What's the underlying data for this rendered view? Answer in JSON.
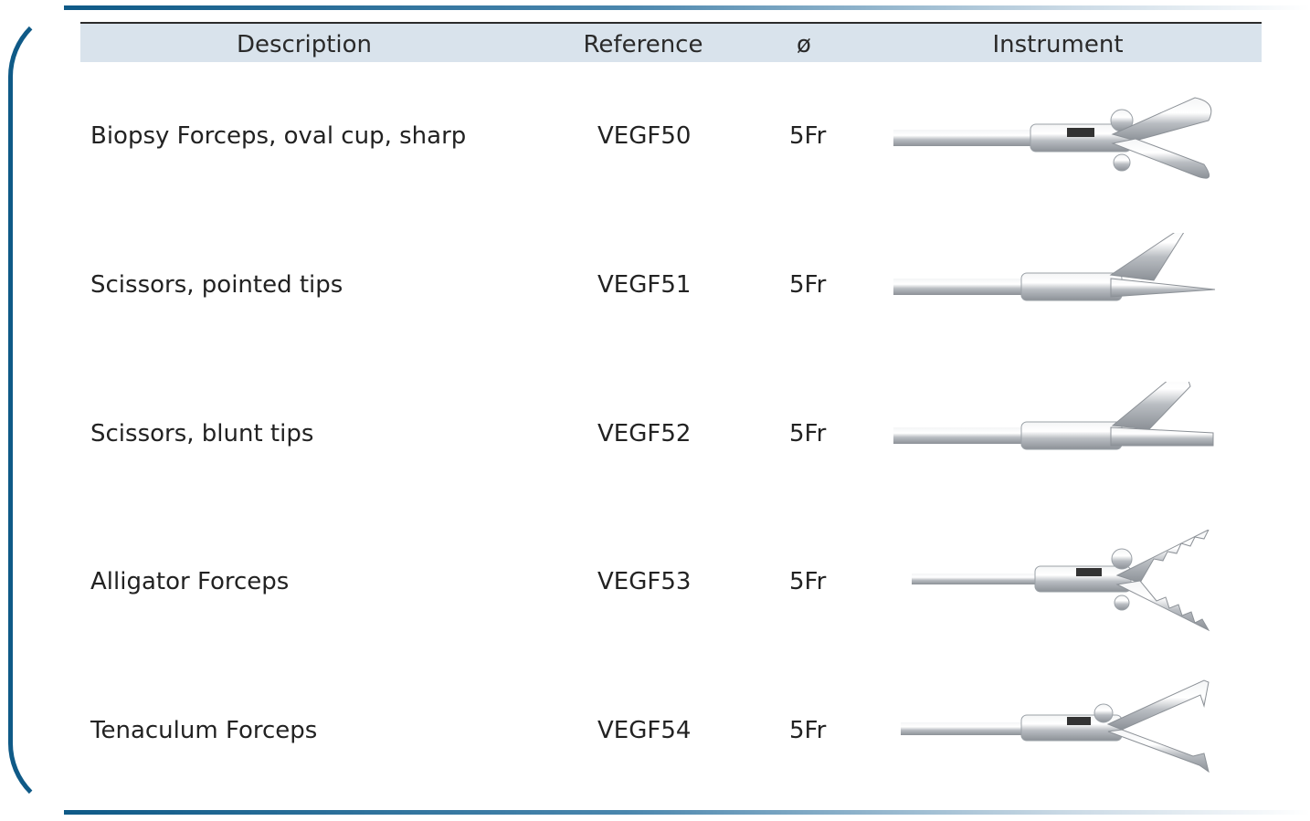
{
  "table": {
    "headers": {
      "description": "Description",
      "reference": "Reference",
      "diameter": "ø",
      "instrument": "Instrument"
    },
    "rows": [
      {
        "description": "Biopsy Forceps, oval cup, sharp",
        "reference": "VEGF50",
        "diameter": "5Fr",
        "instrument_icon": "biopsy-forceps-icon"
      },
      {
        "description": "Scissors, pointed tips",
        "reference": "VEGF51",
        "diameter": "5Fr",
        "instrument_icon": "pointed-scissors-icon"
      },
      {
        "description": "Scissors, blunt tips",
        "reference": "VEGF52",
        "diameter": "5Fr",
        "instrument_icon": "blunt-scissors-icon"
      },
      {
        "description": "Alligator Forceps",
        "reference": "VEGF53",
        "diameter": "5Fr",
        "instrument_icon": "alligator-forceps-icon"
      },
      {
        "description": "Tenaculum Forceps",
        "reference": "VEGF54",
        "diameter": "5Fr",
        "instrument_icon": "tenaculum-forceps-icon"
      }
    ]
  },
  "colors": {
    "frame": "#0f5a87",
    "header_bg": "#d9e3ec",
    "metal": "#c9ccd0"
  }
}
